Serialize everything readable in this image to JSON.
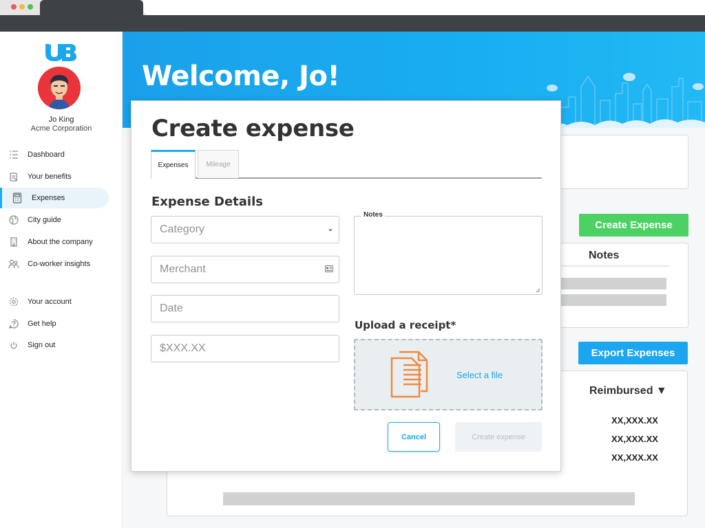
{
  "app": {
    "welcome": "Welcome, Jo!"
  },
  "user": {
    "name": "Jo King",
    "company": "Acme Corporation"
  },
  "sidebar": {
    "items": [
      {
        "label": "Dashboard",
        "icon": "list-icon"
      },
      {
        "label": "Your benefits",
        "icon": "clipboard-icon"
      },
      {
        "label": "Expenses",
        "icon": "calculator-icon",
        "active": true
      },
      {
        "label": "City guide",
        "icon": "globe-icon"
      },
      {
        "label": "About the company",
        "icon": "building-icon"
      },
      {
        "label": "Co-worker insights",
        "icon": "people-icon"
      },
      {
        "label": "Your account",
        "icon": "gear-icon"
      },
      {
        "label": "Get help",
        "icon": "help-icon"
      },
      {
        "label": "Sign out",
        "icon": "power-icon"
      }
    ]
  },
  "background": {
    "create_expense_button": "Create Expense",
    "export_expenses_button": "Export Expenses",
    "notes_header": "Notes",
    "reimbursed_header": "Reimbursed ▼",
    "reimbursed_values": [
      "XX,XXX.XX",
      "XX,XXX.XX",
      "XX,XXX.XX"
    ]
  },
  "modal": {
    "title": "Create expense",
    "tabs": [
      {
        "label": "Expenses",
        "active": true
      },
      {
        "label": "Mileage",
        "active": false
      }
    ],
    "section_title": "Expense Details",
    "fields": {
      "category_placeholder": "Category",
      "merchant_placeholder": "Merchant",
      "date_placeholder": "Date",
      "amount_placeholder": "$XXX.XX"
    },
    "notes_label": "Notes",
    "upload_title": "Upload a receipt*",
    "select_file": "Select a file",
    "cancel_button": "Cancel",
    "create_button": "Create expense"
  },
  "colors": {
    "accent_blue": "#1ba6ef",
    "green": "#4cd264"
  }
}
